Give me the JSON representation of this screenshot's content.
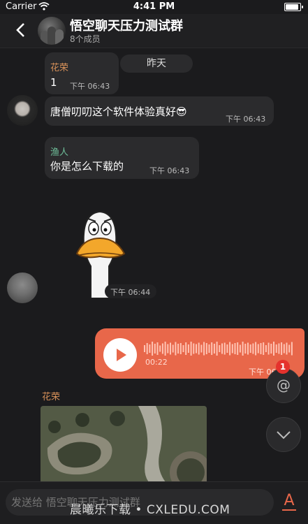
{
  "status": {
    "carrier": "Carrier",
    "time": "4:41 PM"
  },
  "header": {
    "title": "悟空聊天压力测试群",
    "subtitle": "8个成员"
  },
  "messages": {
    "m1": {
      "sender": "花荣",
      "text": "1",
      "time": "下午 06:43"
    },
    "date_divider": "昨天",
    "m2": {
      "text": "唐僧叨叨这个软件体验真好😎",
      "time": "下午 06:43"
    },
    "m3": {
      "sender": "渔人",
      "text": "你是怎么下载的",
      "time": "下午 06:43"
    },
    "sticker": {
      "time": "下午 06:44"
    },
    "voice": {
      "duration": "00:22",
      "time": "下午 06",
      "progress": 0
    },
    "m5": {
      "sender": "花荣"
    }
  },
  "floating": {
    "mention_icon": "@",
    "mention_badge": "1",
    "scroll_down_icon": "chevron-down"
  },
  "input": {
    "placeholder": "发送给 悟空聊天压力测试群"
  },
  "watermark": "晨曦乐下载 • CXLEDU.COM",
  "colors": {
    "accent": "#e8674a",
    "sender_huarong": "#d9925a",
    "sender_yuren": "#6fbf9a",
    "bubble": "#2b2b2d",
    "background": "#1b1b1d"
  }
}
